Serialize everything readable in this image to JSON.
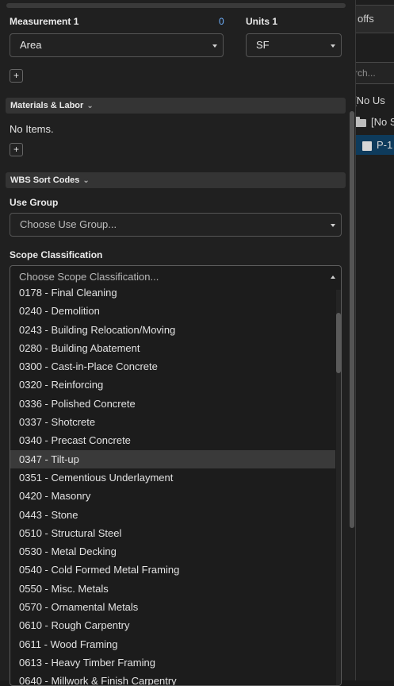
{
  "background": {
    "tab_label": "offs",
    "search_placeholder": "rch...",
    "rows": [
      "[No Us",
      "[No S",
      "P-1"
    ]
  },
  "measurement": {
    "label": "Measurement 1",
    "count": "0",
    "value": "Area"
  },
  "units": {
    "label": "Units 1",
    "value": "SF"
  },
  "add_label": "+",
  "materials": {
    "header": "Materials & Labor",
    "empty_text": "No Items."
  },
  "wbs": {
    "header": "WBS Sort Codes"
  },
  "use_group": {
    "label": "Use Group",
    "placeholder": "Choose Use Group..."
  },
  "scope": {
    "label": "Scope Classification",
    "placeholder": "Choose Scope Classification...",
    "highlighted": "0347 - Tilt-up",
    "options": [
      "0178 - Final Cleaning",
      "0240 - Demolition",
      "0243 - Building Relocation/Moving",
      "0280 - Building Abatement",
      "0300 - Cast-in-Place Concrete",
      "0320 - Reinforcing",
      "0336 - Polished Concrete",
      "0337 - Shotcrete",
      "0340 - Precast Concrete",
      "0347 - Tilt-up",
      "0351 - Cementious Underlayment",
      "0420 - Masonry",
      "0443 - Stone",
      "0510 - Structural Steel",
      "0530 - Metal Decking",
      "0540 - Cold Formed Metal Framing",
      "0550 - Misc. Metals",
      "0570 - Ornamental Metals",
      "0610 - Rough Carpentry",
      "0611 - Wood Framing",
      "0613 - Heavy Timber Framing",
      "0640 - Millwork & Finish Carpentry"
    ]
  }
}
